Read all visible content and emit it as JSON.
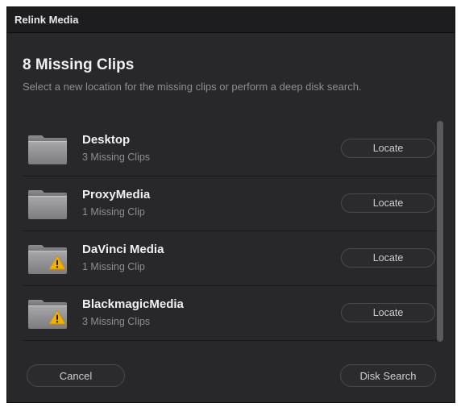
{
  "window": {
    "title": "Relink Media"
  },
  "header": {
    "title": "8 Missing Clips",
    "subtitle": "Select a new location for the missing clips or perform a deep disk search."
  },
  "folders": [
    {
      "name": "Desktop",
      "missing": "3 Missing Clips",
      "warning": false,
      "locate_label": "Locate",
      "icon": "folder-icon"
    },
    {
      "name": "ProxyMedia",
      "missing": "1 Missing Clip",
      "warning": false,
      "locate_label": "Locate",
      "icon": "folder-icon"
    },
    {
      "name": "DaVinci Media",
      "missing": "1 Missing Clip",
      "warning": true,
      "locate_label": "Locate",
      "icon": "folder-warning-icon"
    },
    {
      "name": "BlackmagicMedia",
      "missing": "3 Missing Clips",
      "warning": true,
      "locate_label": "Locate",
      "icon": "folder-warning-icon"
    }
  ],
  "buttons": {
    "cancel": "Cancel",
    "disk_search": "Disk Search"
  },
  "colors": {
    "background": "#28282a",
    "titlebar": "#1d1d1f",
    "warning": "#f2b100",
    "text_primary": "#f0f0f0",
    "text_secondary": "#8e8e90"
  }
}
